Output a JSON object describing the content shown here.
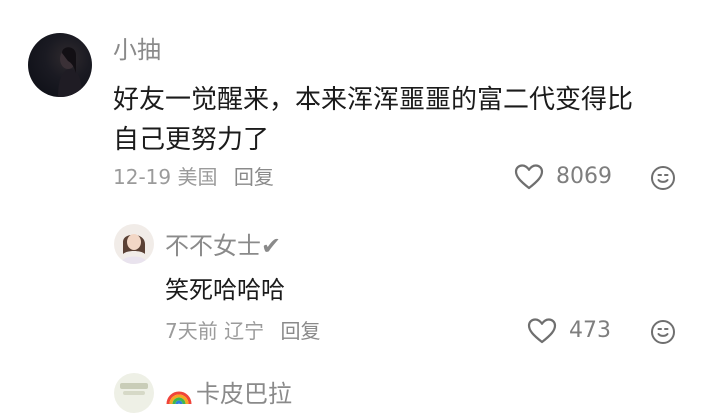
{
  "comments": [
    {
      "username": "小抽",
      "content_line1": "好友一觉醒来，本来浑浑噩噩的富二代变得比",
      "content_line2": "自己更努力了",
      "date": "12-19",
      "location": "美国",
      "reply_label": "回复",
      "likes": "8069",
      "like_icon": "heart-outline-icon",
      "react_icon": "emoji-smile-icon"
    }
  ],
  "replies": [
    {
      "username": "不不女士✔",
      "content": "笑死哈哈哈",
      "date": "7天前",
      "location": "辽宁",
      "reply_label": "回复",
      "likes": "473",
      "like_icon": "heart-outline-icon",
      "react_icon": "emoji-smile-icon"
    },
    {
      "username": "卡皮巴拉",
      "username_prefix_icon": "rainbow-icon"
    }
  ],
  "colors": {
    "text_primary": "#1b1b1b",
    "text_secondary": "#8a8a8a",
    "icon_gray": "#6f6f6f",
    "background": "#ffffff"
  }
}
